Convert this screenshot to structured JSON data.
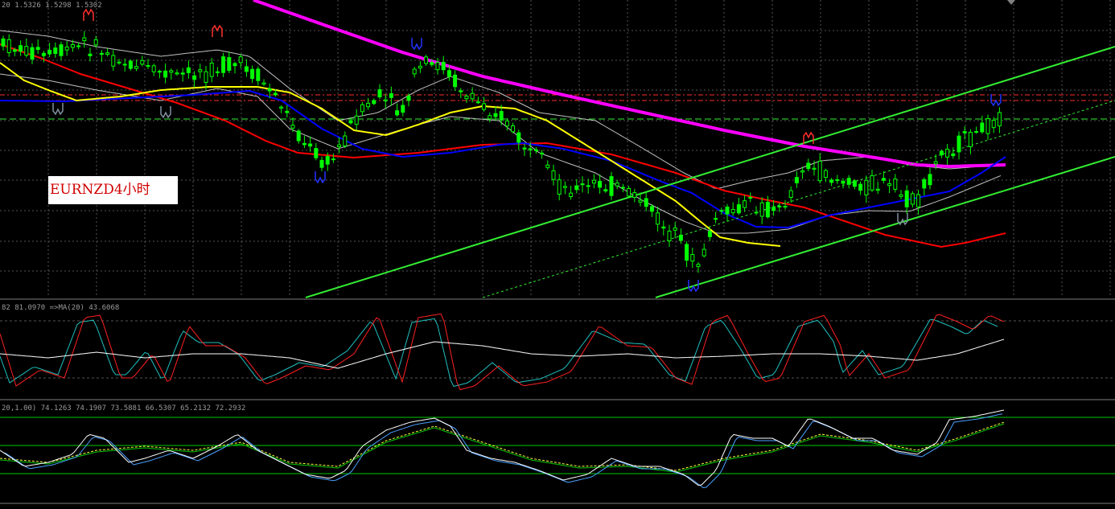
{
  "main_header": "20 1.5326 1.5298 1.5302",
  "osc1_header": "82 81.0970  =>MA(20) 43.6068",
  "osc2_header": "20,1.00) 74.1263 74.1907 73.5881 66.5307 65.2132 72.2932",
  "symbol_label": "EURNZD4小时",
  "colors": {
    "background": "#000000",
    "grid": "#555555",
    "candle": "#00ff00",
    "sma_long": "#ff00ff",
    "ma_red": "#ff0000",
    "ma_blue": "#0000ff",
    "ma_yellow": "#ffff00",
    "envelope": "#c0c0c0",
    "channel": "#33ee33",
    "resistance": "#ff3030",
    "support": "#33ee33",
    "fractal_up": "#ff3030",
    "fractal_down": "#2233ff",
    "osc_red": "#ff2020",
    "osc_cyan": "#20c0c0",
    "osc_white": "#ffffff",
    "osc_green": "#00cc00",
    "osc_yellow": "#ffff40",
    "osc_blue": "#4aa0ff"
  },
  "chart_data": [
    {
      "type": "candlestick",
      "title": "EURNZD4小时",
      "ohlc_last": {
        "high": 1.5326,
        "low": 1.5298,
        "close": 1.5302
      },
      "trend": "down then up-channel"
    },
    {
      "type": "line",
      "series": [
        {
          "name": "MA(20)",
          "last_value": 43.6068
        }
      ],
      "last_fast": 81.097
    },
    {
      "type": "line",
      "series_last": [
        74.1263,
        74.1907,
        73.5881,
        66.5307,
        65.2132,
        72.2932
      ]
    }
  ]
}
